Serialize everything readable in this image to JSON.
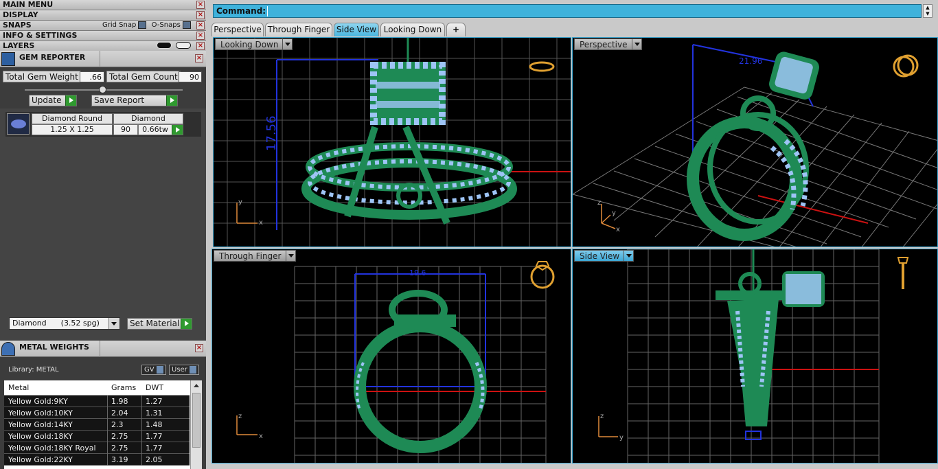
{
  "menu": {
    "items": [
      {
        "label": "MAIN MENU"
      },
      {
        "label": "DISPLAY"
      },
      {
        "label": "SNAPS"
      },
      {
        "label": "INFO & SETTINGS"
      },
      {
        "label": "LAYERS"
      }
    ],
    "snaps": {
      "grid_snap": "Grid Snap",
      "o_snaps": "O-Snaps"
    }
  },
  "gem_reporter": {
    "title": "GEM REPORTER",
    "total_weight_label": "Total Gem Weight",
    "total_weight_value": ".66",
    "total_count_label": "Total Gem Count",
    "total_count_value": "90",
    "update_label": "Update",
    "save_report_label": "Save Report",
    "table": {
      "headers": [
        "Diamond Round",
        "Diamond"
      ],
      "row": {
        "size": "1.25 X 1.25",
        "count": "90",
        "weight": "0.66tw"
      }
    },
    "material_select": "Diamond      (3.52 spg)",
    "set_material_label": "Set Material"
  },
  "metal_weights": {
    "title": "METAL WEIGHTS",
    "library": "Library: METAL",
    "gv_label": "GV",
    "user_label": "User",
    "columns": [
      "Metal",
      "Grams",
      "DWT"
    ],
    "rows": [
      {
        "metal": "Yellow Gold:9KY",
        "grams": "1.98",
        "dwt": "1.27"
      },
      {
        "metal": "Yellow Gold:10KY",
        "grams": "2.04",
        "dwt": "1.31"
      },
      {
        "metal": "Yellow Gold:14KY",
        "grams": "2.3",
        "dwt": "1.48"
      },
      {
        "metal": "Yellow Gold:18KY",
        "grams": "2.75",
        "dwt": "1.77"
      },
      {
        "metal": "Yellow Gold:18KY Royal",
        "grams": "2.75",
        "dwt": "1.77"
      },
      {
        "metal": "Yellow Gold:22KY",
        "grams": "3.19",
        "dwt": "2.05"
      }
    ]
  },
  "command": {
    "label": "Command:"
  },
  "tabs": [
    {
      "label": "Perspective"
    },
    {
      "label": "Through Finger"
    },
    {
      "label": "Side View"
    },
    {
      "label": "Looking Down"
    },
    {
      "label": "+"
    }
  ],
  "viewports": {
    "top_left": {
      "label": "Looking Down",
      "dim": "17.56"
    },
    "top_right": {
      "label": "Perspective",
      "dim": "21.96"
    },
    "bottom_left": {
      "label": "Through Finger",
      "dim": "19.6"
    },
    "bottom_right": {
      "label": "Side View"
    }
  },
  "colors": {
    "model_green": "#1e8a55",
    "gem_blue": "#9ec4f5",
    "grid": "#555555",
    "accent_cyan": "#3fb2db",
    "dimension_blue": "#2233dd",
    "axis_red": "#cc1111"
  }
}
